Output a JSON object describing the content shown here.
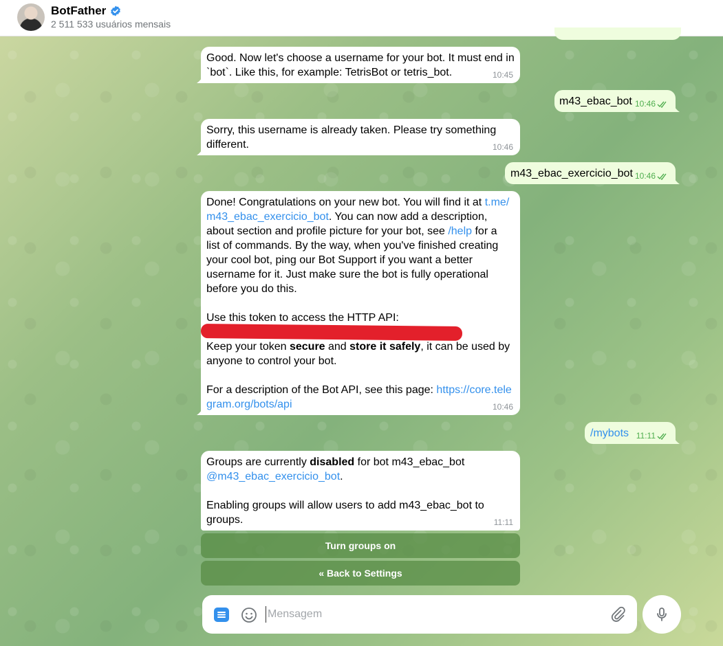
{
  "header": {
    "title": "BotFather",
    "subtitle": "2 511 533 usuários mensais"
  },
  "messages": [
    {
      "dir": "in",
      "lines": [
        "Good. Now let's choose a username for your bot. It must end in",
        "`bot`. Like this, for example: TetrisBot or tetris_bot."
      ],
      "time": "10:45"
    },
    {
      "dir": "out",
      "text": "m43_ebac_bot",
      "time": "10:46"
    },
    {
      "dir": "in",
      "lines": [
        "Sorry, this username is already taken. Please try something",
        "different."
      ],
      "time": "10:46"
    },
    {
      "dir": "out",
      "text": "m43_ebac_exercicio_bot",
      "time": "10:46"
    },
    {
      "dir": "in",
      "time": "10:46",
      "p1a": "Done! Congratulations on your new bot. You will find it at ",
      "link1a": "t.me/",
      "link1b": "m43_ebac_exercicio_bot",
      "p1b": ". You can now add a description,",
      "p1c": "about section and profile picture for your bot, see ",
      "link2": "/help",
      "p1d": " for a",
      "p1e": "list of commands. By the way, when you've finished creating",
      "p1f": "your cool bot, ping our Bot Support if you want a better",
      "p1g": "username for it. Just make sure the bot is fully operational",
      "p1h": "before you do this.",
      "p2": "Use this token to access the HTTP API:",
      "p3a": "Keep your token ",
      "p3b": "secure",
      "p3c": " and ",
      "p3d": "store it safely",
      "p3e": ", it can be used by",
      "p3f": "anyone to control your bot.",
      "p4a": "For a description of the Bot API, see this page: ",
      "link3a": "https://core.tele",
      "link3b": "gram.org/bots/api"
    },
    {
      "dir": "out",
      "text": "/mybots",
      "time": "11:11"
    },
    {
      "dir": "in",
      "time": "11:11",
      "g1a": "Groups are currently ",
      "g1b": "disabled",
      "g1c": " for bot m43_ebac_bot",
      "g1link": "@m43_ebac_exercicio_bot",
      "g1d": ".",
      "g2a": "Enabling groups will allow users to add m43_ebac_bot to",
      "g2b": "groups."
    }
  ],
  "keyboard": {
    "buttons": [
      "Turn groups on",
      "« Back to Settings"
    ]
  },
  "composer": {
    "placeholder": "Mensagem"
  },
  "colors": {
    "incoming_bubble": "#ffffff",
    "outgoing_bubble": "#effdde",
    "link": "#3390ec",
    "check": "#4fae4e",
    "redaction": "#e3202b"
  }
}
